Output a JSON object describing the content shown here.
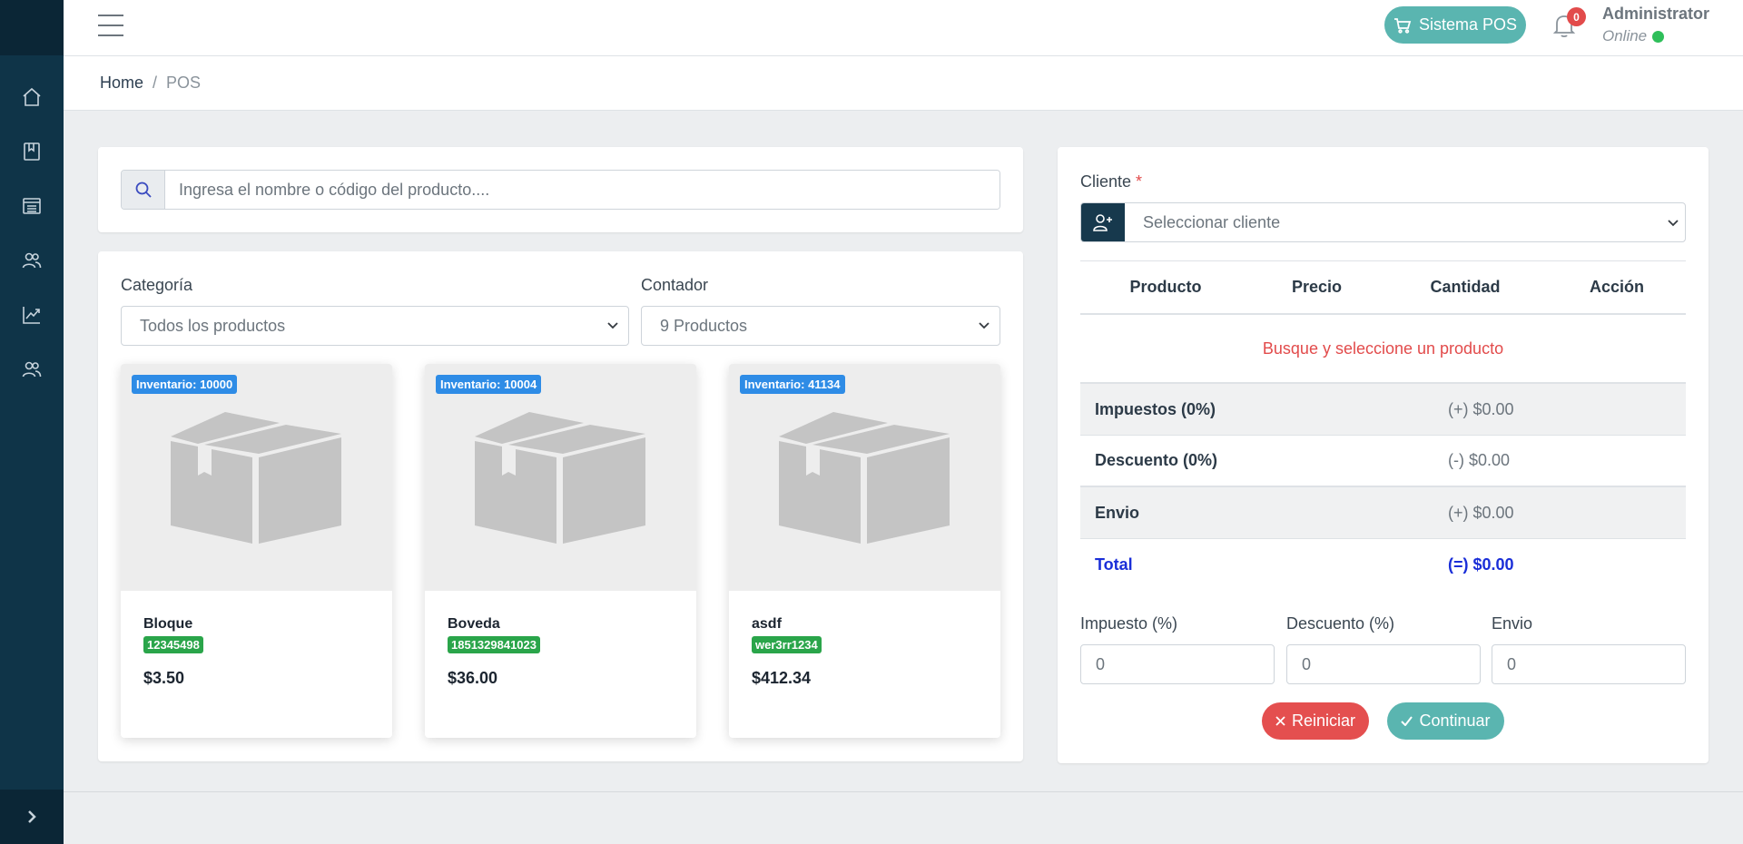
{
  "header": {
    "pos_button_label": "Sistema POS",
    "notification_count": "0",
    "user_name": "Administrator",
    "user_status": "Online"
  },
  "breadcrumb": {
    "home": "Home",
    "separator": "/",
    "current": "POS"
  },
  "search": {
    "placeholder": "Ingresa el nombre o código del producto...."
  },
  "filters": {
    "category_label": "Categoría",
    "category_value": "Todos los productos",
    "counter_label": "Contador",
    "counter_value": "9 Productos"
  },
  "products": [
    {
      "inventory": "Inventario: 10000",
      "name": "Bloque",
      "code": "12345498",
      "price": "$3.50"
    },
    {
      "inventory": "Inventario: 10004",
      "name": "Boveda",
      "code": "1851329841023",
      "price": "$36.00"
    },
    {
      "inventory": "Inventario: 41134",
      "name": "asdf",
      "code": "wer3rr1234",
      "price": "$412.34"
    }
  ],
  "cart": {
    "client_label": "Cliente",
    "client_required": "*",
    "client_placeholder": "Seleccionar cliente",
    "columns": [
      "Producto",
      "Precio",
      "Cantidad",
      "Acción"
    ],
    "empty_message": "Busque y seleccione un producto",
    "summary": [
      {
        "label": "Impuestos (0%)",
        "value": "(+) $0.00"
      },
      {
        "label": "Descuento (0%)",
        "value": "(-) $0.00"
      },
      {
        "label": "Envio",
        "value": "(+) $0.00"
      },
      {
        "label": "Total",
        "value": "(=) $0.00"
      }
    ],
    "tax_label": "Impuesto (%)",
    "tax_value": "0",
    "discount_label": "Descuento (%)",
    "discount_value": "0",
    "shipping_label": "Envio",
    "shipping_value": "0",
    "reset_label": "Reiniciar",
    "continue_label": "Continuar"
  },
  "colors": {
    "sidebar": "#0f3448",
    "accent_teal": "#5ab5b0",
    "danger": "#e44f4f",
    "inventory_badge": "#2e8ce6",
    "code_badge": "#2aa54a",
    "total_blue": "#1a2ed8"
  }
}
